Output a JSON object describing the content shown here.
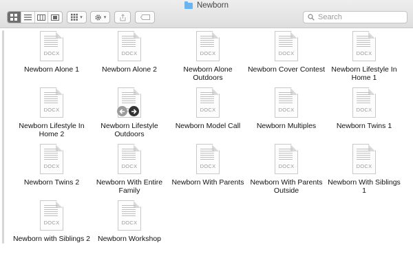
{
  "window": {
    "title": "Newborn"
  },
  "toolbar": {
    "search_placeholder": "Search"
  },
  "files": [
    {
      "name": "Newborn Alone 1",
      "ext": "DOCX"
    },
    {
      "name": "Newborn Alone 2",
      "ext": "DOCX"
    },
    {
      "name": "Newborn Alone Outdoors",
      "ext": "DOCX"
    },
    {
      "name": "Newborn Cover Contest",
      "ext": "DOCX"
    },
    {
      "name": "Newborn Lifestyle In Home 1",
      "ext": "DOCX"
    },
    {
      "name": "Newborn Lifestyle In Home 2",
      "ext": "DOCX"
    },
    {
      "name": "Newborn Lifestyle Outdoors",
      "ext": "DOCX"
    },
    {
      "name": "Newborn Model Call",
      "ext": "DOCX"
    },
    {
      "name": "Newborn Multiples",
      "ext": "DOCX"
    },
    {
      "name": "Newborn Twins 1",
      "ext": "DOCX"
    },
    {
      "name": "Newborn Twins 2",
      "ext": "DOCX"
    },
    {
      "name": "Newborn With Entire Family",
      "ext": "DOCX"
    },
    {
      "name": "Newborn With Parents",
      "ext": "DOCX"
    },
    {
      "name": "Newborn With Parents Outside",
      "ext": "DOCX"
    },
    {
      "name": "Newborn With Siblings 1",
      "ext": "DOCX"
    },
    {
      "name": "Newborn with Siblings 2",
      "ext": "DOCX"
    },
    {
      "name": "Newborn Workshop",
      "ext": "DOCX"
    }
  ],
  "colors": {
    "accent": "#6cb4ef",
    "selected_segment": "#6e6e6e"
  }
}
